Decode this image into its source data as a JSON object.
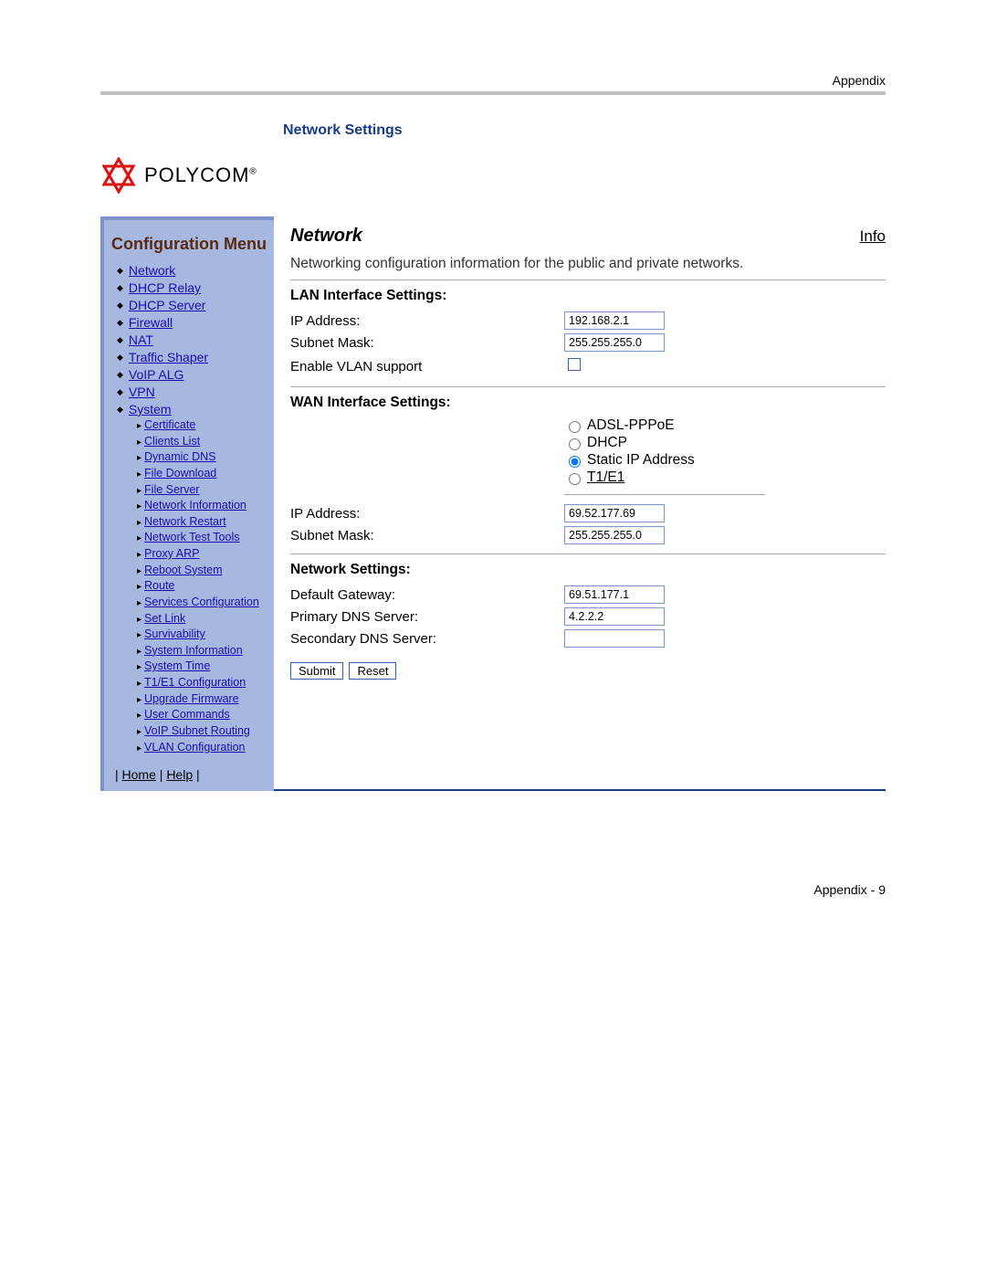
{
  "header": {
    "appendix": "Appendix",
    "section_title": "Network Settings",
    "brand": "POLYCOM"
  },
  "sidebar": {
    "title": "Configuration Menu",
    "items": [
      {
        "label": "Network"
      },
      {
        "label": "DHCP Relay"
      },
      {
        "label": "DHCP Server"
      },
      {
        "label": "Firewall"
      },
      {
        "label": "NAT"
      },
      {
        "label": "Traffic Shaper"
      },
      {
        "label": "VoIP ALG"
      },
      {
        "label": "VPN"
      },
      {
        "label": "System"
      }
    ],
    "sub_items": [
      {
        "label": "Certificate"
      },
      {
        "label": "Clients List"
      },
      {
        "label": "Dynamic DNS"
      },
      {
        "label": "File Download"
      },
      {
        "label": "File Server"
      },
      {
        "label": "Network Information"
      },
      {
        "label": "Network Restart"
      },
      {
        "label": "Network Test Tools"
      },
      {
        "label": "Proxy ARP"
      },
      {
        "label": "Reboot System"
      },
      {
        "label": "Route"
      },
      {
        "label": "Services Configuration"
      },
      {
        "label": "Set Link"
      },
      {
        "label": "Survivability"
      },
      {
        "label": "System Information"
      },
      {
        "label": "System Time"
      },
      {
        "label": "T1/E1 Configuration"
      },
      {
        "label": "Upgrade Firmware"
      },
      {
        "label": "User Commands"
      },
      {
        "label": "VoIP Subnet Routing"
      },
      {
        "label": "VLAN Configuration"
      }
    ],
    "footer": {
      "home": "Home",
      "help": "Help"
    }
  },
  "content": {
    "title": "Network",
    "info_link": "Info",
    "description": "Networking configuration information for the public and private networks.",
    "lan": {
      "heading": "LAN Interface Settings:",
      "ip_label": "IP Address:",
      "ip_value": "192.168.2.1",
      "mask_label": "Subnet Mask:",
      "mask_value": "255.255.255.0",
      "vlan_label": "Enable VLAN support"
    },
    "wan": {
      "heading": "WAN Interface Settings:",
      "options": {
        "opt1": "ADSL-PPPoE",
        "opt2": "DHCP",
        "opt3": "Static IP Address",
        "opt4": "T1/E1"
      },
      "ip_label": "IP Address:",
      "ip_value": "69.52.177.69",
      "mask_label": "Subnet Mask:",
      "mask_value": "255.255.255.0"
    },
    "net": {
      "heading": "Network Settings:",
      "gw_label": "Default Gateway:",
      "gw_value": "69.51.177.1",
      "dns1_label": "Primary DNS Server:",
      "dns1_value": "4.2.2.2",
      "dns2_label": "Secondary DNS Server:",
      "dns2_value": ""
    },
    "buttons": {
      "submit": "Submit",
      "reset": "Reset"
    }
  },
  "footer": {
    "page": "Appendix - 9"
  }
}
